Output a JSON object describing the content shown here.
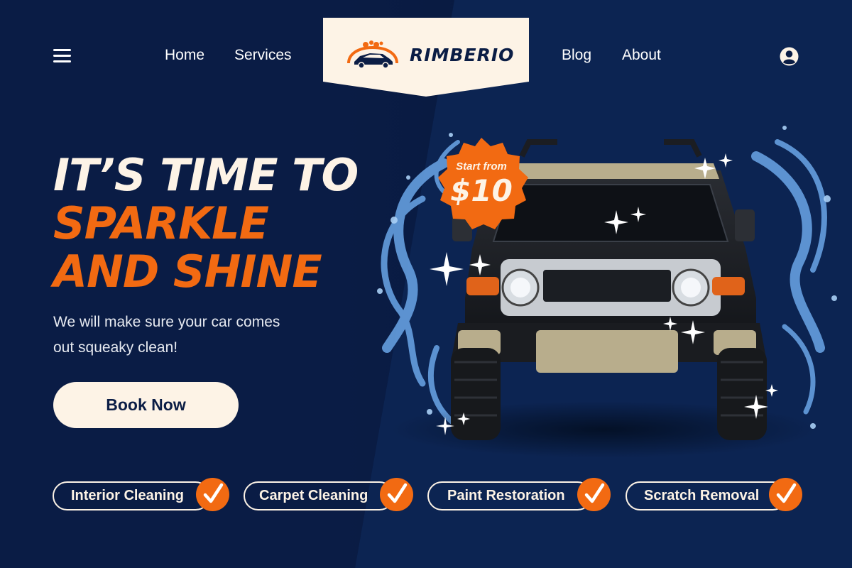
{
  "nav": {
    "links_left": [
      "Home",
      "Services"
    ],
    "links_right": [
      "Blog",
      "About"
    ],
    "brand": "RIMBERIO",
    "menu_icon": "hamburger-icon",
    "user_icon": "user-circle-icon"
  },
  "hero": {
    "line1": "IT’S TIME TO",
    "line2": "SPARKLE",
    "line3": "AND SHINE",
    "subtitle": "We will make sure your car comes out squeaky clean!",
    "cta_label": "Book Now"
  },
  "badge": {
    "caption": "Start from",
    "price": "$10"
  },
  "services": [
    {
      "label": "Interior Cleaning",
      "icon": "check-icon"
    },
    {
      "label": "Carpet Cleaning",
      "icon": "check-icon"
    },
    {
      "label": "Paint Restoration",
      "icon": "check-icon"
    },
    {
      "label": "Scratch Removal",
      "icon": "check-icon"
    }
  ],
  "colors": {
    "background": "#081a40",
    "accent": "#f26a12",
    "cream": "#fdf3e6"
  }
}
